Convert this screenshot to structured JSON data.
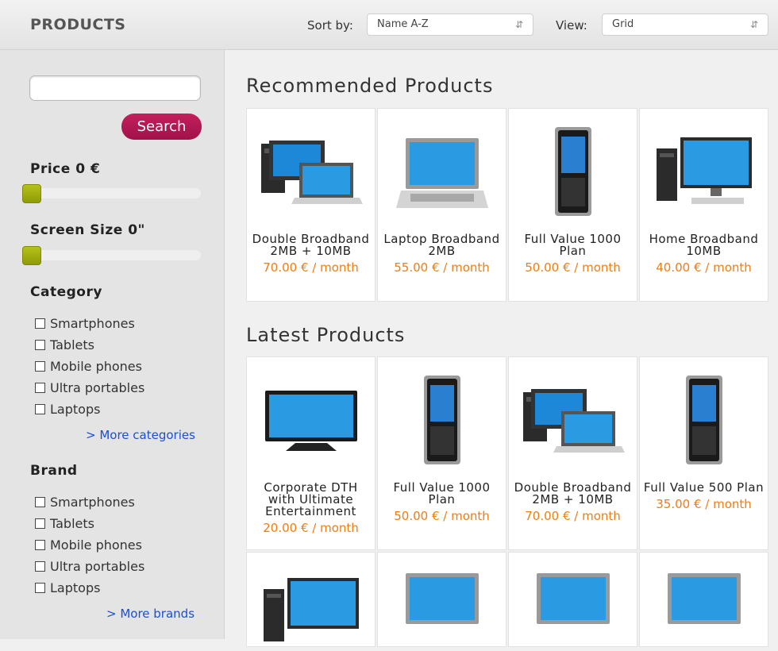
{
  "header": {
    "title": "PRODUCTS",
    "sort_label": "Sort by:",
    "sort_value": "Name A-Z",
    "view_label": "View:",
    "view_value": "Grid"
  },
  "sidebar": {
    "search_placeholder": "",
    "search_button": "Search",
    "price_label": "Price 0 €",
    "price_level": 0,
    "screen_label": "Screen Size 0\"",
    "screen_level": 0,
    "category_heading": "Category",
    "categories": [
      "Smartphones",
      "Tablets",
      "Mobile phones",
      "Ultra portables",
      "Laptops"
    ],
    "more_categories": "> More categories",
    "brand_heading": "Brand",
    "brands": [
      "Smartphones",
      "Tablets",
      "Mobile phones",
      "Ultra portables",
      "Laptops"
    ],
    "more_brands": "> More brands"
  },
  "recommended": {
    "title": "Recommended Products",
    "items": [
      {
        "name": "Double Broadband 2MB + 10MB",
        "price": "70.00 € / month",
        "icon": "desktop-laptop-icon"
      },
      {
        "name": "Laptop Broadband 2MB",
        "price": "55.00 € / month",
        "icon": "laptop-icon"
      },
      {
        "name": "Full Value 1000 Plan",
        "price": "50.00 € / month",
        "icon": "mobile-phone-icon"
      },
      {
        "name": "Home Broadband 10MB",
        "price": "40.00 € / month",
        "icon": "desktop-computer-icon"
      }
    ]
  },
  "latest": {
    "title": "Latest Products",
    "items": [
      {
        "name": "Corporate DTH with Ultimate Entertainment",
        "price": "20.00 € / month",
        "icon": "tv-icon"
      },
      {
        "name": "Full Value 1000 Plan",
        "price": "50.00 € / month",
        "icon": "mobile-phone-icon"
      },
      {
        "name": "Double Broadband 2MB + 10MB",
        "price": "70.00 € / month",
        "icon": "desktop-laptop-icon"
      },
      {
        "name": "Full Value 500 Plan",
        "price": "35.00 € / month",
        "icon": "mobile-phone-icon"
      }
    ],
    "partial_icons": [
      "desktop-computer-icon",
      "laptop-icon",
      "laptop-icon",
      "laptop-icon"
    ]
  },
  "colors": {
    "accent": "#b3174f",
    "price": "#f07c12",
    "slider": "#9fab0c",
    "link": "#1a4fd6"
  }
}
